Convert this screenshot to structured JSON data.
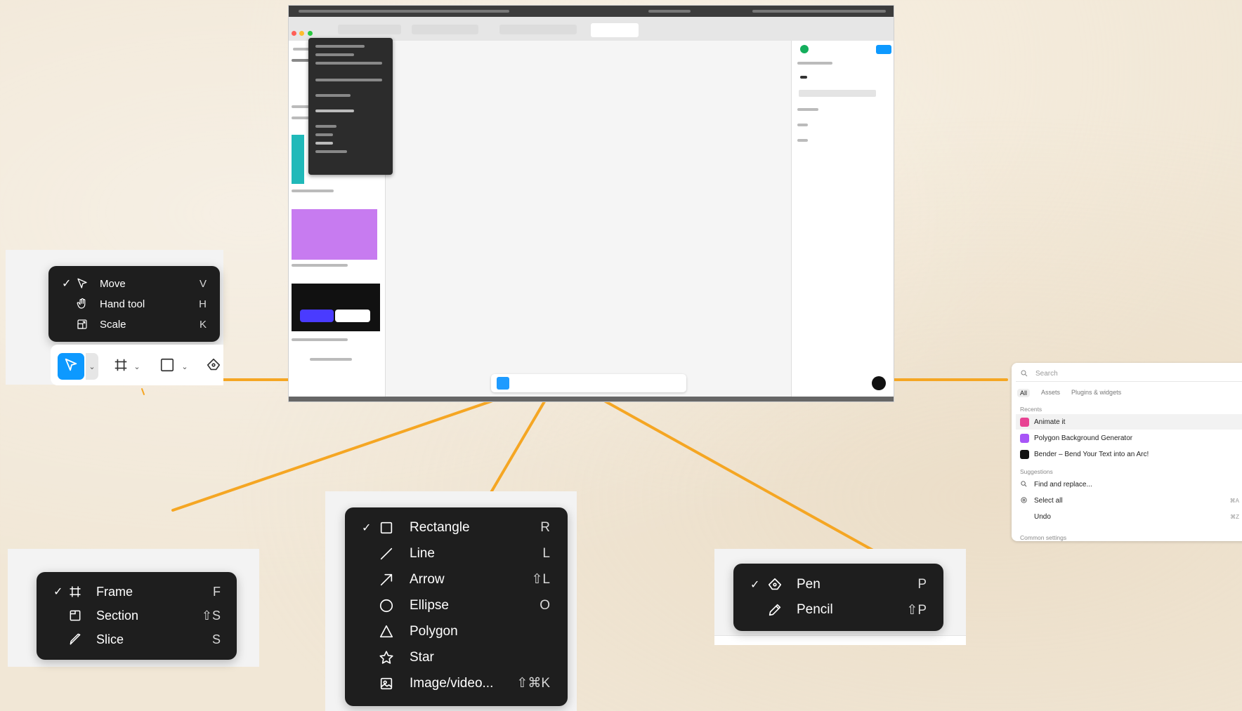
{
  "colors": {
    "accent": "#0d99ff",
    "connector": "#f5a623",
    "menu_bg": "#1e1e1e"
  },
  "move_menu": {
    "items": [
      {
        "label": "Move",
        "shortcut": "V",
        "checked": true,
        "icon": "move-cursor-icon"
      },
      {
        "label": "Hand tool",
        "shortcut": "H",
        "checked": false,
        "icon": "hand-icon"
      },
      {
        "label": "Scale",
        "shortcut": "K",
        "checked": false,
        "icon": "scale-icon"
      }
    ]
  },
  "frame_menu": {
    "items": [
      {
        "label": "Frame",
        "shortcut": "F",
        "checked": true,
        "icon": "frame-icon"
      },
      {
        "label": "Section",
        "shortcut": "⇧S",
        "checked": false,
        "icon": "section-icon"
      },
      {
        "label": "Slice",
        "shortcut": "S",
        "checked": false,
        "icon": "slice-icon"
      }
    ]
  },
  "shape_menu": {
    "items": [
      {
        "label": "Rectangle",
        "shortcut": "R",
        "checked": true,
        "icon": "rectangle-icon"
      },
      {
        "label": "Line",
        "shortcut": "L",
        "checked": false,
        "icon": "line-icon"
      },
      {
        "label": "Arrow",
        "shortcut": "⇧L",
        "checked": false,
        "icon": "arrow-icon"
      },
      {
        "label": "Ellipse",
        "shortcut": "O",
        "checked": false,
        "icon": "ellipse-icon"
      },
      {
        "label": "Polygon",
        "shortcut": "",
        "checked": false,
        "icon": "polygon-icon"
      },
      {
        "label": "Star",
        "shortcut": "",
        "checked": false,
        "icon": "star-icon"
      },
      {
        "label": "Image/video...",
        "shortcut": "⇧⌘K",
        "checked": false,
        "icon": "image-icon"
      }
    ]
  },
  "pen_menu": {
    "items": [
      {
        "label": "Pen",
        "shortcut": "P",
        "checked": true,
        "icon": "pen-icon"
      },
      {
        "label": "Pencil",
        "shortcut": "⇧P",
        "checked": false,
        "icon": "pencil-icon"
      }
    ]
  },
  "actions_panel": {
    "search_placeholder": "Search",
    "tabs": [
      "All",
      "Assets",
      "Plugins & widgets"
    ],
    "recents_label": "Recents",
    "recents": [
      {
        "label": "Animate it",
        "icon_color": "#e84393"
      },
      {
        "label": "Polygon Background Generator",
        "icon_color": "#a855f7"
      },
      {
        "label": "Bender – Bend Your Text into an Arc!",
        "icon_color": "#111111"
      }
    ],
    "suggestions_label": "Suggestions",
    "suggestions": [
      {
        "label": "Find and replace...",
        "shortcut": "",
        "icon": "search-icon"
      },
      {
        "label": "Select all",
        "shortcut": "⌘A",
        "icon": "target-icon"
      },
      {
        "label": "Undo",
        "shortcut": "⌘Z",
        "icon": ""
      }
    ],
    "common_settings_label": "Common settings"
  }
}
